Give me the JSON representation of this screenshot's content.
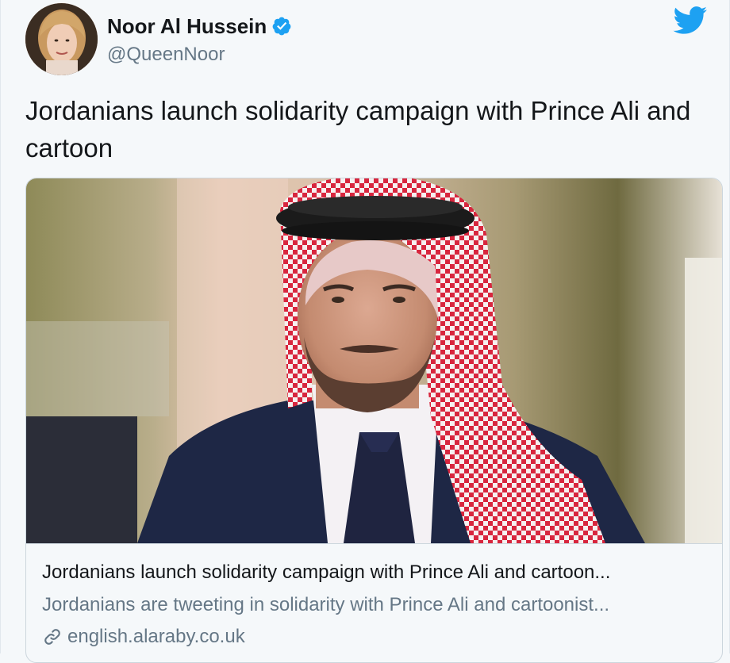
{
  "author": {
    "display_name": "Noor Al Hussein",
    "handle": "@QueenNoor",
    "verified": true,
    "avatar_icon": "profile-photo"
  },
  "brand_icon": "twitter-bird-icon",
  "tweet": {
    "text": "Jordanians launch solidarity campaign with Prince Ali and cartoon"
  },
  "card": {
    "image_icon": "photo-of-man-in-red-keffiyeh",
    "title": "Jordanians launch solidarity campaign with Prince Ali and cartoon...",
    "description": "Jordanians are tweeting in solidarity with Prince Ali and cartoonist...",
    "domain": "english.alaraby.co.uk"
  },
  "colors": {
    "twitter_blue": "#1da1f2",
    "text_primary": "#14171a",
    "text_secondary": "#657786",
    "border": "#ccd6dd",
    "background": "#f5f8fa"
  }
}
